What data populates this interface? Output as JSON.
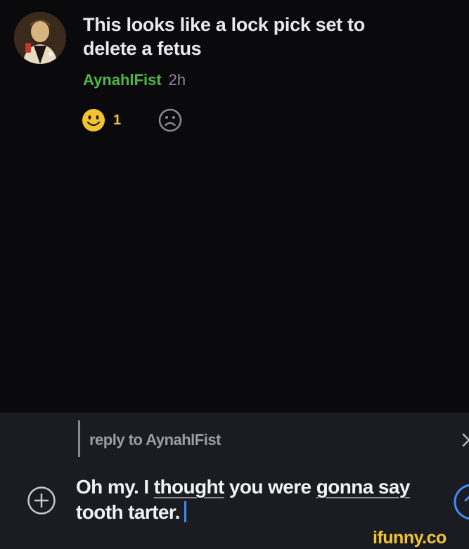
{
  "comment": {
    "text": "This looks like a lock pick set to delete a fetus",
    "username": "AynahlFist",
    "time": "2h",
    "smile_count": "1",
    "smile_icon": "smile-emoji-icon",
    "frown_icon": "frown-emoji-icon"
  },
  "composer": {
    "reply_to": "reply to AynahlFist",
    "text_parts": [
      "Oh my. I ",
      "thought",
      " you were ",
      "gonna say",
      " tooth tarter."
    ],
    "add_icon": "plus-circle-icon",
    "close_icon": "close-icon",
    "send_icon": "send-icon"
  },
  "watermark": "ifunny.co",
  "colors": {
    "background": "#0a0a0d",
    "composer_background": "#1b1c22",
    "username": "#4fb748",
    "reaction_yellow": "#f4c430",
    "caret": "#3d8df5",
    "send_blue": "#3d8df5"
  }
}
